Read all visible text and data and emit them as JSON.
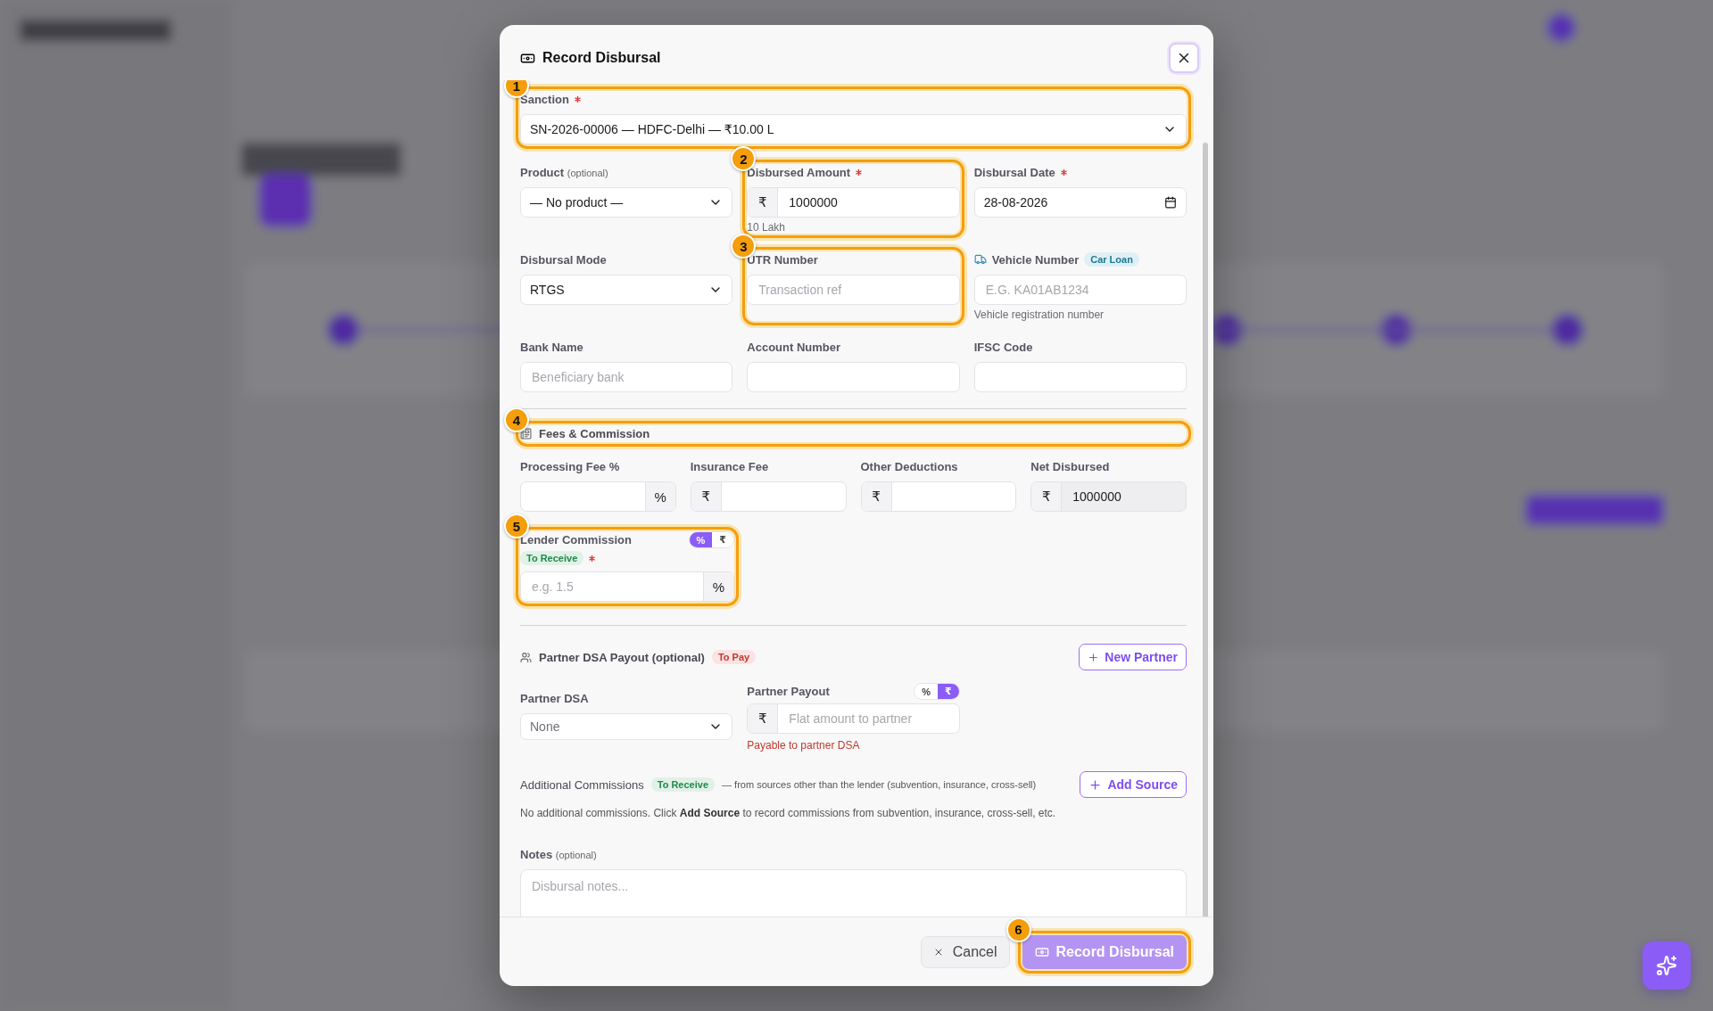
{
  "dialog": {
    "title": "Record Disbursal"
  },
  "sanction": {
    "label": "Sanction",
    "required": true,
    "value": "SN-2026-00006 — HDFC-Delhi — ₹10.00 L",
    "callout": "1"
  },
  "fields": [
    {
      "kind": "select",
      "label": "Product",
      "note": "(optional)",
      "value": "— No product —"
    },
    {
      "kind": "amount",
      "label": "Disbursed Amount",
      "required": true,
      "prefix": "₹",
      "value": "1000000",
      "hint": "10 Lakh",
      "callout": "2"
    },
    {
      "kind": "date",
      "label": "Disbursal Date",
      "required": true,
      "value": "28-08-2026"
    },
    {
      "kind": "select",
      "label": "Disbursal Mode",
      "value": "RTGS"
    },
    {
      "kind": "text",
      "label": "UTR Number",
      "placeholder": "Transaction ref",
      "callout": "3"
    },
    {
      "kind": "vehicle",
      "label": "Vehicle Number",
      "tag": {
        "label": "Car Loan",
        "kind": "info"
      },
      "placeholder": "E.G. KA01AB1234",
      "hint": "Vehicle registration number"
    },
    {
      "kind": "text",
      "label": "Bank Name",
      "placeholder": "Beneficiary bank"
    },
    {
      "kind": "text",
      "label": "Account Number"
    },
    {
      "kind": "text",
      "label": "IFSC Code"
    }
  ],
  "fees": {
    "title": "Fees & Commission",
    "callout": "4",
    "fields": [
      {
        "kind": "suffix",
        "label": "Processing Fee %",
        "suffix": "%"
      },
      {
        "kind": "prefix",
        "label": "Insurance Fee",
        "prefix": "₹"
      },
      {
        "kind": "prefix",
        "label": "Other Deductions",
        "prefix": "₹"
      },
      {
        "kind": "readonly",
        "label": "Net Disbursed",
        "prefix": "₹",
        "value": "1000000"
      }
    ],
    "lender_commission": {
      "label": "Lender Commission",
      "tag": {
        "label": "To Receive",
        "kind": "receive"
      },
      "required": true,
      "toggle": [
        {
          "label": "%",
          "selected": true
        },
        {
          "label": "₹",
          "selected": false
        }
      ],
      "placeholder": "e.g. 1.5",
      "suffix": "%",
      "callout": "5"
    }
  },
  "partner": {
    "title": "Partner DSA Payout (optional)",
    "tag": {
      "label": "To Pay",
      "kind": "pay"
    },
    "button": "New Partner",
    "dsa": {
      "label": "Partner DSA",
      "value": "None"
    },
    "payout": {
      "label": "Partner Payout",
      "toggle": [
        {
          "label": "%",
          "selected": false
        },
        {
          "label": "₹",
          "selected": true
        }
      ],
      "prefix": "₹",
      "placeholder": "Flat amount to partner",
      "hint": "Payable to partner DSA"
    }
  },
  "additional": {
    "title": "Additional Commissions",
    "tag": {
      "label": "To Receive",
      "kind": "receive"
    },
    "description": "— from sources other than the lender (subvention, insurance, cross-sell)",
    "button": "Add Source",
    "empty_text": "No additional commissions. Click **Add Source** to record commissions from subvention, insurance, cross-sell, etc."
  },
  "notes": {
    "label": "Notes",
    "note": "(optional)",
    "placeholder": "Disbursal notes..."
  },
  "footer": {
    "cancel": "Cancel",
    "submit": {
      "label": "Record Disbursal",
      "disabled": true,
      "callout": "6"
    }
  }
}
